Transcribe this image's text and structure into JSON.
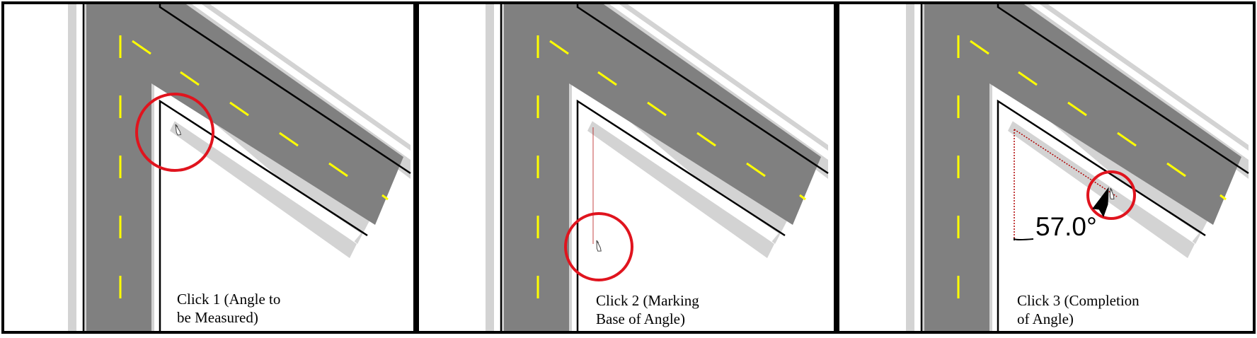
{
  "panels": [
    {
      "caption_line1": "Click 1 (Angle to",
      "caption_line2": "be Measured)"
    },
    {
      "caption_line1": "Click 2 (Marking",
      "caption_line2": "Base of Angle)"
    },
    {
      "caption_line1": "Click 3 (Completion",
      "caption_line2": "of Angle)",
      "angle_readout": "57.0°"
    }
  ],
  "colors": {
    "road_surface": "#808080",
    "road_shoulder": "#d3d3d3",
    "lane_marking": "#ffff00",
    "highlight_circle": "#e0141e",
    "measure_line": "#b00000",
    "frame": "#000000"
  }
}
